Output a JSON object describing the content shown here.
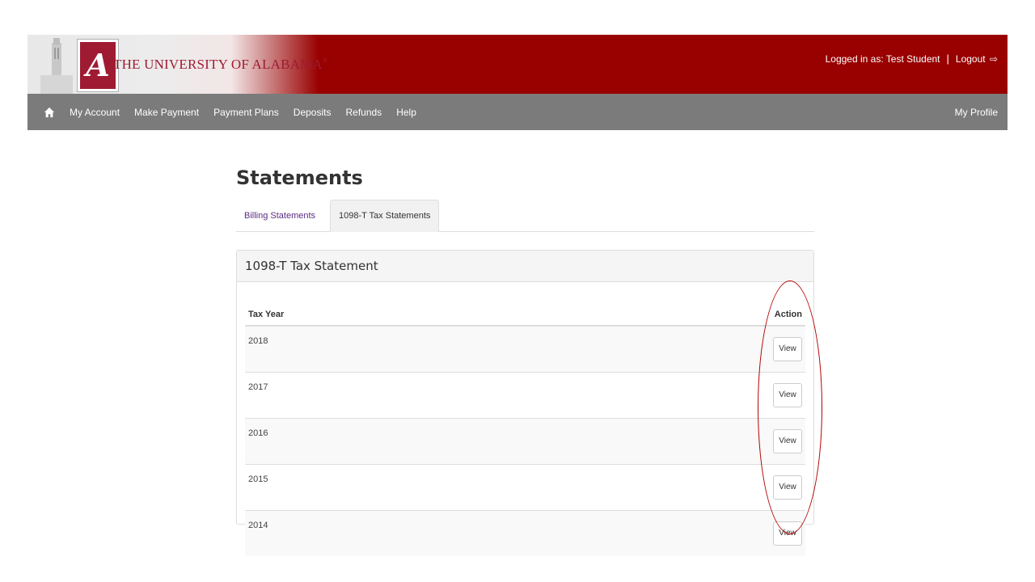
{
  "header": {
    "university_name": "THE UNIVERSITY OF ALABAMA",
    "registered_mark": "®",
    "logo_letter": "A",
    "logged_in_text": "Logged in as: Test Student",
    "separator": "|",
    "logout_label": "Logout",
    "logout_icon": "logout-icon"
  },
  "nav": {
    "home_icon": "home-icon",
    "items": [
      {
        "label": "My Account"
      },
      {
        "label": "Make Payment"
      },
      {
        "label": "Payment Plans"
      },
      {
        "label": "Deposits"
      },
      {
        "label": "Refunds"
      },
      {
        "label": "Help"
      }
    ],
    "right_label": "My Profile"
  },
  "page": {
    "title": "Statements",
    "tabs": [
      {
        "label": "Billing Statements",
        "active": false
      },
      {
        "label": "1098-T Tax Statements",
        "active": true
      }
    ]
  },
  "panel": {
    "heading": "1098-T Tax Statement",
    "columns": {
      "tax_year": "Tax Year",
      "action": "Action"
    },
    "rows": [
      {
        "year": "2018",
        "action_label": "View"
      },
      {
        "year": "2017",
        "action_label": "View"
      },
      {
        "year": "2016",
        "action_label": "View"
      },
      {
        "year": "2015",
        "action_label": "View"
      },
      {
        "year": "2014",
        "action_label": "View"
      }
    ]
  },
  "colors": {
    "header_red": "#990000",
    "nav_gray": "#7b7b7b",
    "tab_link": "#5a2d82",
    "highlight_circle": "#b30000"
  }
}
